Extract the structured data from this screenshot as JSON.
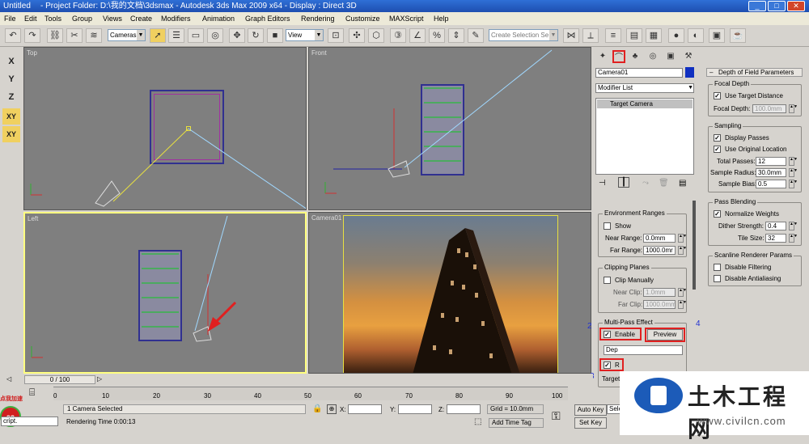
{
  "window": {
    "app_label": "Untitled",
    "title": "- Project Folder: D:\\我的文档\\3dsmax     - Autodesk 3ds Max  2009 x64     - Display : Direct 3D",
    "min": "_",
    "max": "□",
    "close": "✕"
  },
  "menu": [
    "File",
    "Edit",
    "Tools",
    "Group",
    "Views",
    "Create",
    "Modifiers",
    "Animation",
    "Graph Editors",
    "Rendering",
    "Customize",
    "MAXScript",
    "Help"
  ],
  "toolbar": {
    "filter_select": "Cameras",
    "refcoord_select": "View",
    "named_selection_placeholder": "Create Selection Se"
  },
  "left_tools": [
    "X",
    "Y",
    "Z",
    "XY",
    "XY"
  ],
  "viewports": {
    "top": "Top",
    "front": "Front",
    "left": "Left",
    "camera": "Camera01"
  },
  "command_panel": {
    "object_name": "Camera01",
    "name_color": "#1030c0",
    "modifier_list": "Modifier List",
    "stack_item": "Target Camera",
    "env_ranges": {
      "title": "Environment Ranges",
      "show": "Show",
      "near_label": "Near Range:",
      "near_value": "0.0mm",
      "far_label": "Far Range:",
      "far_value": "1000.0mr"
    },
    "clipping": {
      "title": "Clipping Planes",
      "manual": "Clip Manually",
      "near_label": "Near Clip:",
      "near_value": "1.0mm",
      "far_label": "Far Clip:",
      "far_value": "1000.0mm"
    },
    "multipass": {
      "title": "Multi-Pass Effect",
      "enable": "Enable",
      "preview": "Preview",
      "effect": "Dep",
      "render_effect": "R",
      "target": "Target"
    }
  },
  "annotations": {
    "n1": "1",
    "n2": "2",
    "n3": "3",
    "n4": "4"
  },
  "dof": {
    "rollout_title": "Depth of Field Parameters",
    "focal_depth": {
      "title": "Focal Depth",
      "use_target": "Use Target Distance",
      "depth_label": "Focal Depth:",
      "depth_value": "100.0mm"
    },
    "sampling": {
      "title": "Sampling",
      "display_passes": "Display Passes",
      "use_original": "Use Original Location",
      "total_label": "Total Passes:",
      "total_value": "12",
      "radius_label": "Sample Radius:",
      "radius_value": "30.0mm",
      "bias_label": "Sample Bias:",
      "bias_value": "0.5"
    },
    "blending": {
      "title": "Pass Blending",
      "normalize": "Normalize Weights",
      "dither_label": "Dither Strength:",
      "dither_value": "0.4",
      "tile_label": "Tile Size:",
      "tile_value": "32"
    },
    "scanline": {
      "title": "Scanline Renderer Params",
      "disable_filtering": "Disable Filtering",
      "disable_aa": "Disable Antialiasing"
    }
  },
  "timeline": {
    "frame": "0 / 100",
    "ticks": [
      "0",
      "10",
      "20",
      "30",
      "40",
      "50",
      "60",
      "70",
      "80",
      "90",
      "100"
    ]
  },
  "status": {
    "selected": "1 Camera Selected",
    "render_time": "Rendering Time  0:00:13",
    "x_label": "X:",
    "y_label": "Y:",
    "z_label": "Z:",
    "grid": "Grid = 10.0mm",
    "add_time_tag": "Add Time Tag",
    "auto_key": "Auto Key",
    "set_key": "Set Key",
    "sel": "Sele",
    "script": "cript.",
    "badge": "93",
    "promo": "点我加速"
  },
  "watermark": {
    "brand": "土木工程网",
    "url": "www.civilcn.com"
  }
}
